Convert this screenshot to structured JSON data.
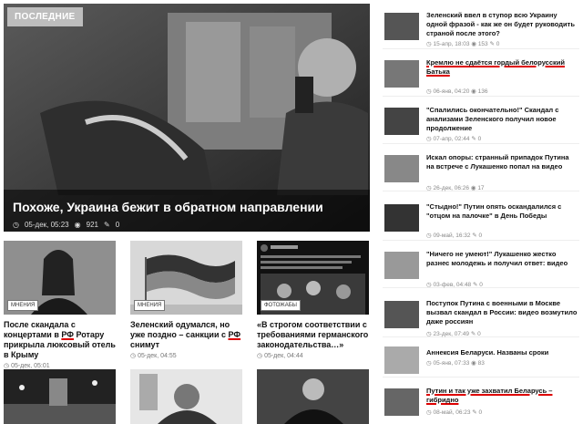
{
  "featured": {
    "tag": "ПОСЛЕДНИЕ",
    "title": "Похоже, Украина бежит в обратном направлении",
    "date": "05-дек, 05:23",
    "views": "921",
    "comments": "0"
  },
  "cards": [
    {
      "badge": "МНЕНИЯ",
      "title_pre": "После скандала с концертами в ",
      "title_hl": "РФ",
      "title_post": " Ротару прикрыла люксовый отель в Крыму",
      "date": "05-дек, 05:01"
    },
    {
      "badge": "МНЕНИЯ",
      "title_pre": "Зеленский одумался, но уже поздно – санкции с ",
      "title_hl": "РФ",
      "title_post": " снимут",
      "date": "05-дек, 04:55"
    },
    {
      "badge": "ФОТОЖАБЫ",
      "title_pre": "«В строгом соответствии с требованиями германского законодательства…»",
      "title_hl": "",
      "title_post": "",
      "date": "05-дек, 04:44"
    }
  ],
  "sidebar": [
    {
      "title": "Зеленский ввел в ступор всю Украину одной фразой - как же он будет руководить страной после этого?",
      "date": "15-апр, 18:03",
      "views": "153",
      "comments": "0"
    },
    {
      "title": "Кремлю не сдаётся гордый белорусский Батька",
      "date": "06-янв, 04:20",
      "views": "136",
      "comments": ""
    },
    {
      "title": "\"Спалились окончательно!\" Скандал с анализами Зеленского получил новое продолжение",
      "date": "07-апр, 02:44",
      "views": "",
      "comments": "0"
    },
    {
      "title": "Искал опоры: странный припадок Путина на встрече с Лукашенко попал на видео",
      "date": "26-дек, 06:26",
      "views": "17",
      "comments": ""
    },
    {
      "title": "\"Стыдно!\" Путин опять оскандалился с \"отцом на палочке\" в День Победы",
      "date": "09-май, 16:32",
      "views": "",
      "comments": "0"
    },
    {
      "title": "\"Ничего не умеют!\" Лукашенко жестко разнес молодежь и получил ответ: видео",
      "date": "03-фев, 04:48",
      "views": "",
      "comments": "0"
    },
    {
      "title": "Поступок Путина с военными в Москве вызвал скандал в России: видео возмутило даже россиян",
      "date": "23-дек, 07:49",
      "views": "",
      "comments": "0"
    },
    {
      "title": "Аннексия Беларуси. Названы сроки",
      "date": "05-янв, 07:33",
      "views": "83",
      "comments": ""
    },
    {
      "title": "Путин и так уже захватил Беларусь – гибридно",
      "date": "08-май, 06:23",
      "views": "",
      "comments": "0"
    }
  ],
  "colors": {
    "accent_underline": "#dd0000",
    "tag_bg": "#bdbdbd"
  }
}
